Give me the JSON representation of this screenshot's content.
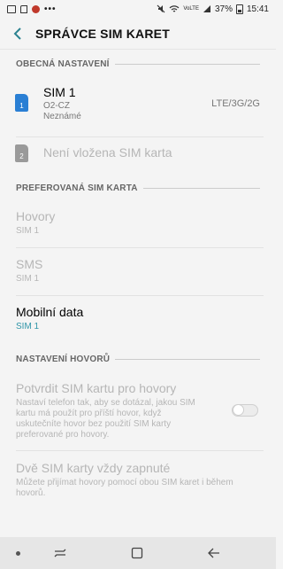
{
  "status_bar": {
    "dots": "•••",
    "battery": "37%",
    "time": "15:41",
    "network": "VoLTE"
  },
  "header": {
    "title": "SPRÁVCE SIM KARET"
  },
  "sections": {
    "general": "OBECNÁ NASTAVENÍ",
    "preferred": "PREFEROVANÁ SIM KARTA",
    "call_settings": "NASTAVENÍ HOVORŮ"
  },
  "sim1": {
    "icon_num": "1",
    "title": "SIM 1",
    "operator": "O2-CZ",
    "number": "Neznámé",
    "network": "LTE/3G/2G",
    "icon_color": "#2a7fd4"
  },
  "sim2": {
    "icon_num": "2",
    "title": "Není vložena SIM karta",
    "icon_color": "#9a9a9a"
  },
  "preferred": {
    "calls_title": "Hovory",
    "calls_value": "SIM 1",
    "sms_title": "SMS",
    "sms_value": "SIM 1",
    "data_title": "Mobilní data",
    "data_value": "SIM 1"
  },
  "calls": {
    "confirm_title": "Potvrdit SIM kartu pro hovory",
    "confirm_desc": "Nastaví telefon tak, aby se dotázal, jakou SIM kartu má použít pro příští hovor, když uskutečníte hovor bez použití SIM karty preferované pro hovory.",
    "confirm_on": false,
    "dual_title": "Dvě SIM karty vždy zapnuté",
    "dual_desc": "Můžete přijímat hovory pomocí obou SIM karet i během hovorů."
  },
  "colors": {
    "accent": "#2f95a8",
    "disabled_text": "#b6b6b6"
  }
}
